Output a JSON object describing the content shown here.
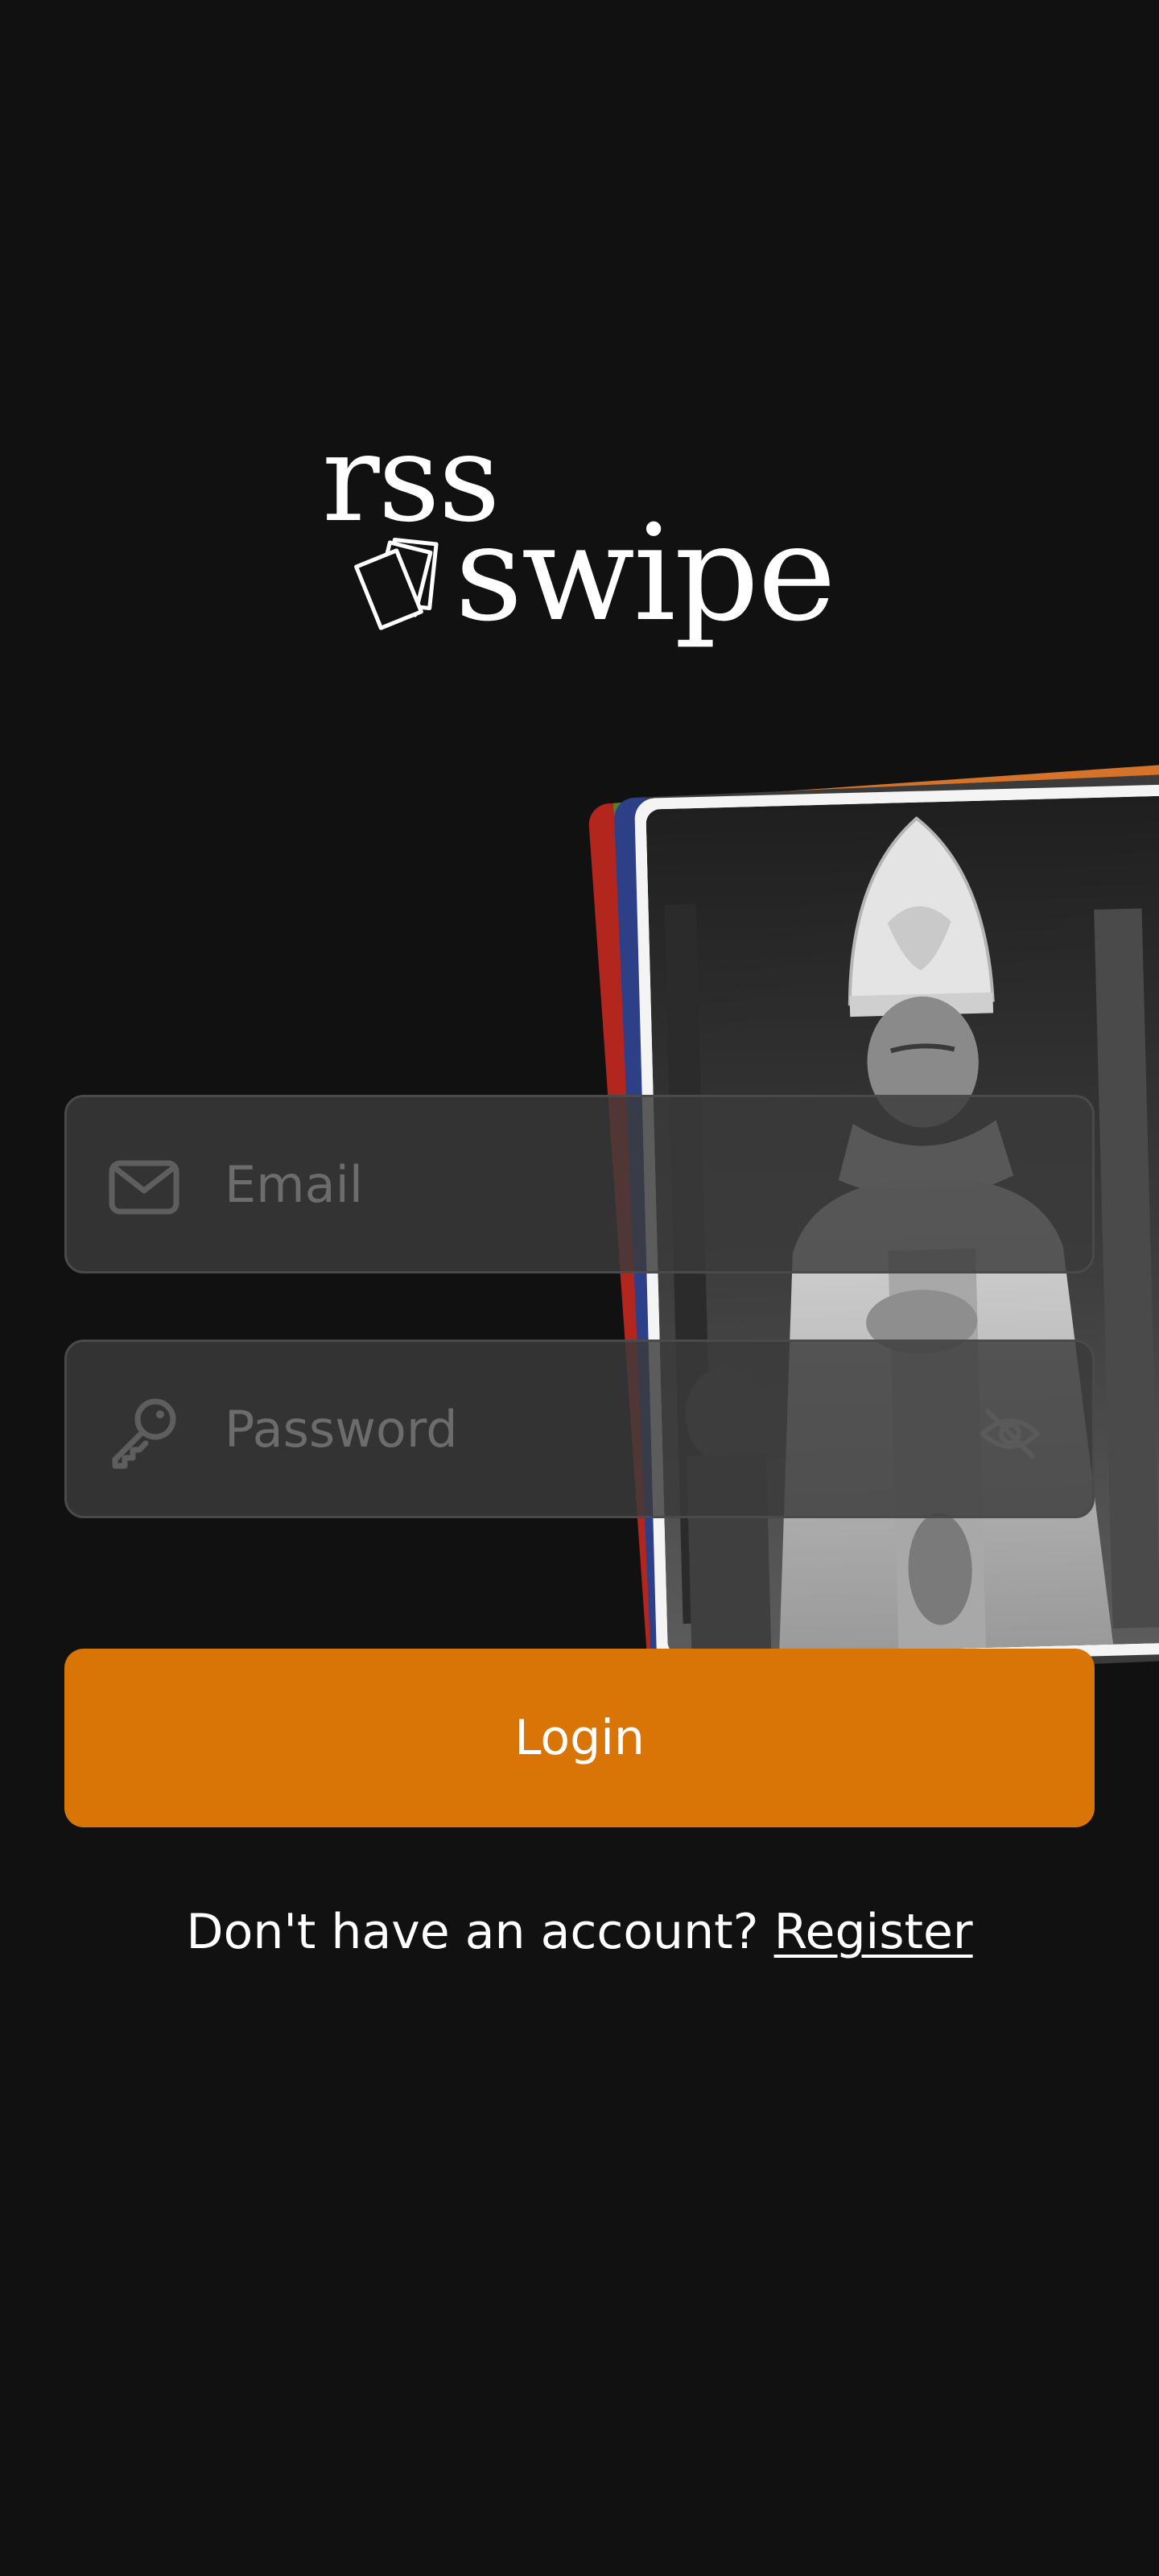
{
  "app": {
    "logo_line1": "rss",
    "logo_line2": "swipe",
    "logo_icon": "stacked-cards-icon"
  },
  "hero_card": {
    "image": "portrait-photo"
  },
  "form": {
    "email": {
      "placeholder": "Email",
      "value": "",
      "icon": "envelope-icon"
    },
    "password": {
      "placeholder": "Password",
      "value": "",
      "icon": "key-icon",
      "toggle_icon": "eye-off-icon"
    },
    "login_label": "Login"
  },
  "footer": {
    "prompt": "Don't have an account?",
    "register_label": "Register"
  },
  "colors": {
    "background": "#111111",
    "accent": "#d97406",
    "field_background": "#3a3a3a",
    "field_border": "#4a4a4a",
    "placeholder": "#6c6c6c",
    "text": "#ffffff"
  }
}
